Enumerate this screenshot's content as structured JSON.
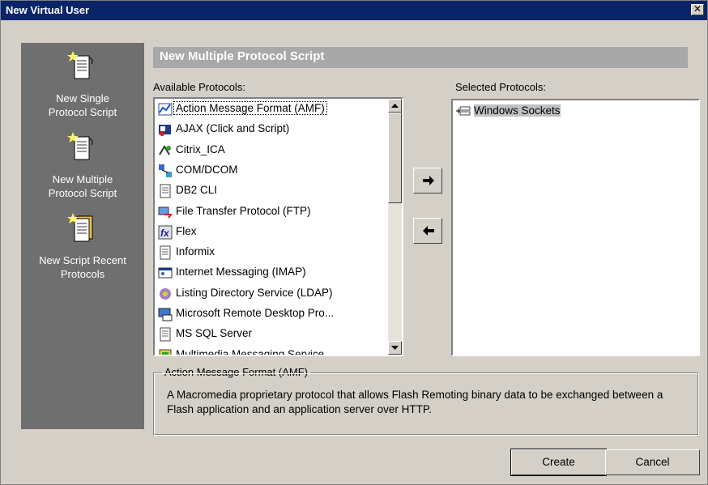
{
  "window": {
    "title": "New Virtual User"
  },
  "sidebar": {
    "items": [
      {
        "label": "New Single Protocol Script",
        "icon": "script-icon"
      },
      {
        "label": "New Multiple Protocol Script",
        "icon": "multi-script-icon"
      },
      {
        "label": "New Script Recent Protocols",
        "icon": "recent-script-icon"
      }
    ]
  },
  "header": {
    "title": "New Multiple Protocol Script"
  },
  "available": {
    "label": "Available Protocols:",
    "items": [
      {
        "label": "Action Message Format (AMF)",
        "icon": "amf-icon",
        "selected": true
      },
      {
        "label": "AJAX (Click and Script)",
        "icon": "ajax-icon"
      },
      {
        "label": "Citrix_ICA",
        "icon": "citrix-icon"
      },
      {
        "label": "COM/DCOM",
        "icon": "com-icon"
      },
      {
        "label": "DB2 CLI",
        "icon": "document-icon"
      },
      {
        "label": "File Transfer Protocol (FTP)",
        "icon": "ftp-icon"
      },
      {
        "label": "Flex",
        "icon": "flex-icon"
      },
      {
        "label": "Informix",
        "icon": "document-icon"
      },
      {
        "label": "Internet Messaging (IMAP)",
        "icon": "imap-icon"
      },
      {
        "label": "Listing Directory Service (LDAP)",
        "icon": "ldap-icon"
      },
      {
        "label": "Microsoft Remote Desktop Pro...",
        "icon": "rdp-icon"
      },
      {
        "label": "MS SQL Server",
        "icon": "document-icon"
      },
      {
        "label": "Multimedia Messaging Service",
        "icon": "mms-icon"
      }
    ]
  },
  "selected": {
    "label": "Selected Protocols:",
    "items": [
      {
        "label": "Windows Sockets",
        "icon": "sockets-icon"
      }
    ]
  },
  "description": {
    "title": "Action Message Format (AMF)",
    "text": "A Macromedia proprietary protocol that allows Flash Remoting binary data to be exchanged between a Flash application and an application server over HTTP."
  },
  "buttons": {
    "create": "Create",
    "cancel": "Cancel"
  },
  "colors": {
    "titlebar": "#0a246a",
    "sidebar": "#6f6f6f",
    "header": "#a8a8a8",
    "face": "#d4d0c8",
    "highlight": "#c0c0c0"
  }
}
